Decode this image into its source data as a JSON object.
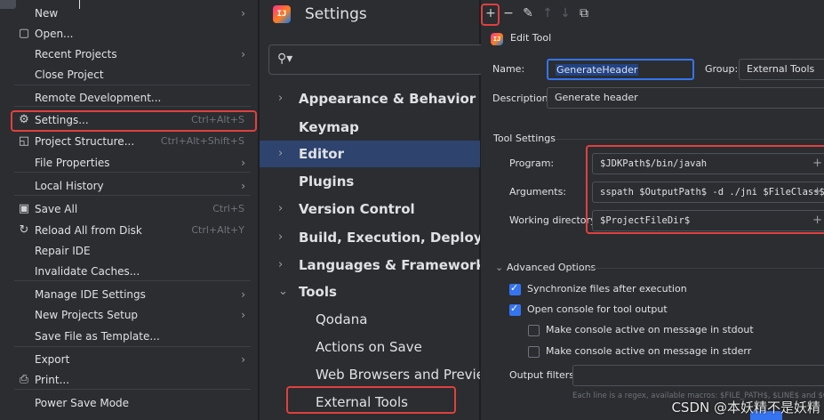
{
  "file_menu": {
    "items": [
      {
        "label": "New",
        "icon": "",
        "shortcut": "",
        "submenu": true
      },
      {
        "label": "Open...",
        "icon": "folder-icon",
        "shortcut": "",
        "submenu": false
      },
      {
        "label": "Recent Projects",
        "icon": "",
        "shortcut": "",
        "submenu": true
      },
      {
        "label": "Close Project",
        "icon": "",
        "shortcut": "",
        "submenu": false
      },
      {
        "label": "Remote Development...",
        "icon": "",
        "shortcut": "",
        "submenu": false
      },
      {
        "label": "Settings...",
        "icon": "gear-icon",
        "shortcut": "Ctrl+Alt+S",
        "submenu": false
      },
      {
        "label": "Project Structure...",
        "icon": "project-structure-icon",
        "shortcut": "Ctrl+Alt+Shift+S",
        "submenu": false
      },
      {
        "label": "File Properties",
        "icon": "",
        "shortcut": "",
        "submenu": true
      },
      {
        "label": "Local History",
        "icon": "",
        "shortcut": "",
        "submenu": true
      },
      {
        "label": "Save All",
        "icon": "save-icon",
        "shortcut": "Ctrl+S",
        "submenu": false
      },
      {
        "label": "Reload All from Disk",
        "icon": "reload-icon",
        "shortcut": "Ctrl+Alt+Y",
        "submenu": false
      },
      {
        "label": "Repair IDE",
        "icon": "",
        "shortcut": "",
        "submenu": false
      },
      {
        "label": "Invalidate Caches...",
        "icon": "",
        "shortcut": "",
        "submenu": false
      },
      {
        "label": "Manage IDE Settings",
        "icon": "",
        "shortcut": "",
        "submenu": true
      },
      {
        "label": "New Projects Setup",
        "icon": "",
        "shortcut": "",
        "submenu": true
      },
      {
        "label": "Save File as Template...",
        "icon": "",
        "shortcut": "",
        "submenu": false
      },
      {
        "label": "Export",
        "icon": "",
        "shortcut": "",
        "submenu": true
      },
      {
        "label": "Print...",
        "icon": "print-icon",
        "shortcut": "",
        "submenu": false
      },
      {
        "label": "Power Save Mode",
        "icon": "",
        "shortcut": "",
        "submenu": false
      }
    ]
  },
  "settings": {
    "title": "Settings",
    "search_icon": "search-icon",
    "nav": [
      {
        "label": "Appearance & Behavior",
        "chevron": "›",
        "bold": true
      },
      {
        "label": "Keymap",
        "chevron": "",
        "bold": true
      },
      {
        "label": "Editor",
        "chevron": "›",
        "bold": true
      },
      {
        "label": "Plugins",
        "chevron": "",
        "bold": true
      },
      {
        "label": "Version Control",
        "chevron": "›",
        "bold": true
      },
      {
        "label": "Build, Execution, Deployment",
        "chevron": "›",
        "bold": true
      },
      {
        "label": "Languages & Frameworks",
        "chevron": "›",
        "bold": true
      },
      {
        "label": "Tools",
        "chevron": "⌄",
        "bold": true
      },
      {
        "label": "Qodana",
        "chevron": "",
        "bold": false
      },
      {
        "label": "Actions on Save",
        "chevron": "",
        "bold": false
      },
      {
        "label": "Web Browsers and Preview",
        "chevron": "",
        "bold": false
      },
      {
        "label": "External Tools",
        "chevron": "",
        "bold": false
      }
    ]
  },
  "edit_tool": {
    "toolbar": [
      "add-icon",
      "remove-icon",
      "edit-icon",
      "move-up-icon",
      "move-down-icon",
      "copy-icon"
    ],
    "toolbar_glyphs": [
      "+",
      "−",
      "✎",
      "↑",
      "↓",
      "⧉"
    ],
    "title": "Edit Tool",
    "name_label": "Name:",
    "name_value": "GenerateHeader",
    "group_label": "Group:",
    "group_value": "External Tools",
    "description_label": "Description:",
    "description_value": "Generate header",
    "tool_settings_label": "Tool Settings",
    "program_label": "Program:",
    "program_value": "$JDKPath$/bin/javah",
    "arguments_label": "Arguments:",
    "arguments_value": "sspath $OutputPath$ -d ./jni $FileClass$",
    "working_dir_label": "Working directory:",
    "working_dir_value": "$ProjectFileDir$",
    "advanced_label": "Advanced Options",
    "options": [
      {
        "label": "Synchronize files after execution",
        "checked": true
      },
      {
        "label": "Open console for tool output",
        "checked": true
      },
      {
        "label": "Make console active on message in stdout",
        "checked": false
      },
      {
        "label": "Make console active on message in stderr",
        "checked": false
      }
    ],
    "output_filters_label": "Output filters:",
    "hint": "Each line is a regex, available macros: $FILE_PATH$, $LINE$ and $COLUMN$"
  },
  "watermark": "CSDN @本妖精不是妖精",
  "colors": {
    "highlight": "#e0403f",
    "selection": "#2e436e",
    "accent": "#3574f0"
  }
}
